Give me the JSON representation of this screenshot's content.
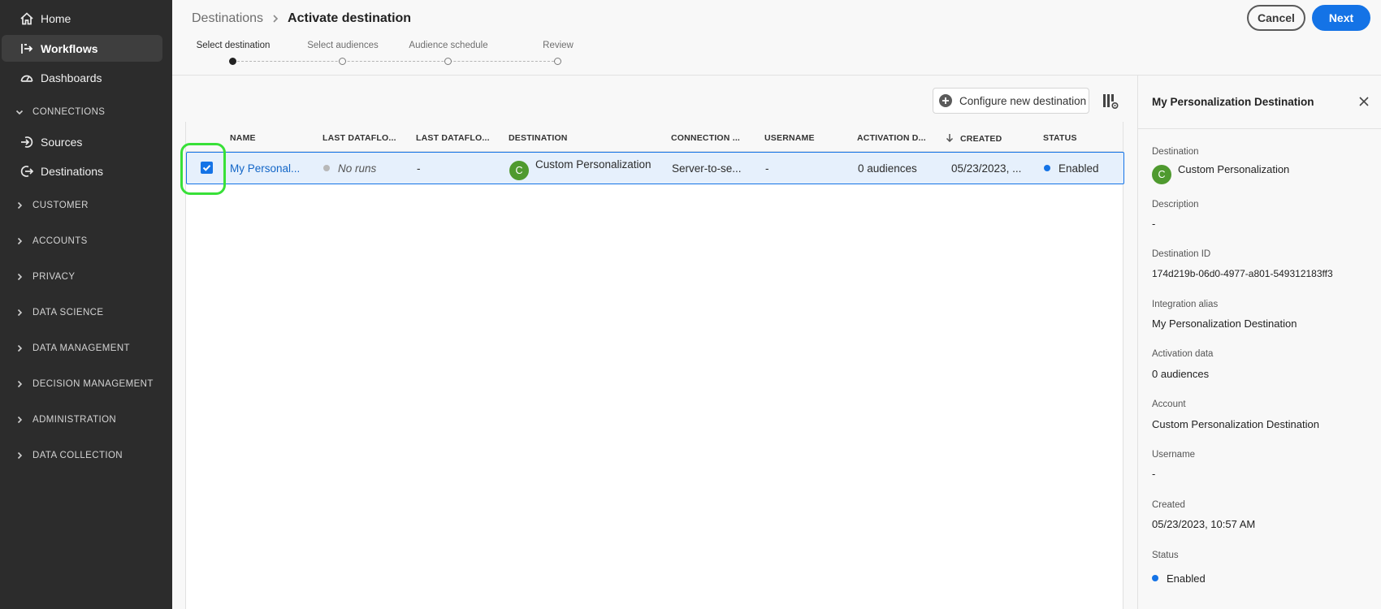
{
  "sidebar": {
    "items": [
      {
        "label": "Home",
        "icon": "home-icon"
      },
      {
        "label": "Workflows",
        "icon": "workflows-icon"
      },
      {
        "label": "Dashboards",
        "icon": "dashboards-icon"
      }
    ],
    "connections_label": "CONNECTIONS",
    "connections": [
      {
        "label": "Sources",
        "icon": "sources-icon"
      },
      {
        "label": "Destinations",
        "icon": "destinations-icon"
      }
    ],
    "sections": [
      "CUSTOMER",
      "ACCOUNTS",
      "PRIVACY",
      "DATA SCIENCE",
      "DATA MANAGEMENT",
      "DECISION MANAGEMENT",
      "ADMINISTRATION",
      "DATA COLLECTION"
    ]
  },
  "header": {
    "breadcrumb_root": "Destinations",
    "breadcrumb_current": "Activate destination",
    "cancel_label": "Cancel",
    "next_label": "Next"
  },
  "stepper": {
    "steps": [
      "Select destination",
      "Select audiences",
      "Audience schedule",
      "Review"
    ],
    "active_index": 0
  },
  "toolbar": {
    "configure_label": "Configure new destination"
  },
  "table": {
    "columns": [
      "NAME",
      "LAST DATAFLO...",
      "LAST DATAFLO...",
      "DESTINATION",
      "CONNECTION ...",
      "USERNAME",
      "ACTIVATION D...",
      "CREATED",
      "STATUS"
    ],
    "sorted_column": "CREATED",
    "rows": [
      {
        "selected": true,
        "name": "My Personal...",
        "last_dataflow_run_status": "No runs",
        "last_dataflow_run_date": "-",
        "destination_initial": "C",
        "destination": "Custom Personalization",
        "connection_type": "Server-to-se...",
        "username": "-",
        "activation_data": "0 audiences",
        "created": "05/23/2023, ...",
        "status": "Enabled"
      }
    ]
  },
  "details": {
    "title": "My Personalization Destination",
    "destination_label": "Destination",
    "destination_initial": "C",
    "destination_value": "Custom Personalization",
    "description_label": "Description",
    "description_value": "-",
    "destination_id_label": "Destination ID",
    "destination_id_value": "174d219b-06d0-4977-a801-549312183ff3",
    "integration_alias_label": "Integration alias",
    "integration_alias_value": "My Personalization Destination",
    "activation_data_label": "Activation data",
    "activation_data_value": "0 audiences",
    "account_label": "Account",
    "account_value": "Custom Personalization Destination",
    "username_label": "Username",
    "username_value": "-",
    "created_label": "Created",
    "created_value": "05/23/2023, 10:57 AM",
    "status_label": "Status",
    "status_value": "Enabled"
  },
  "colors": {
    "accent": "#1473e6",
    "selection_highlight": "#38e038",
    "destination_avatar": "#4f9a2f",
    "sidebar_bg": "#2c2c2c"
  }
}
